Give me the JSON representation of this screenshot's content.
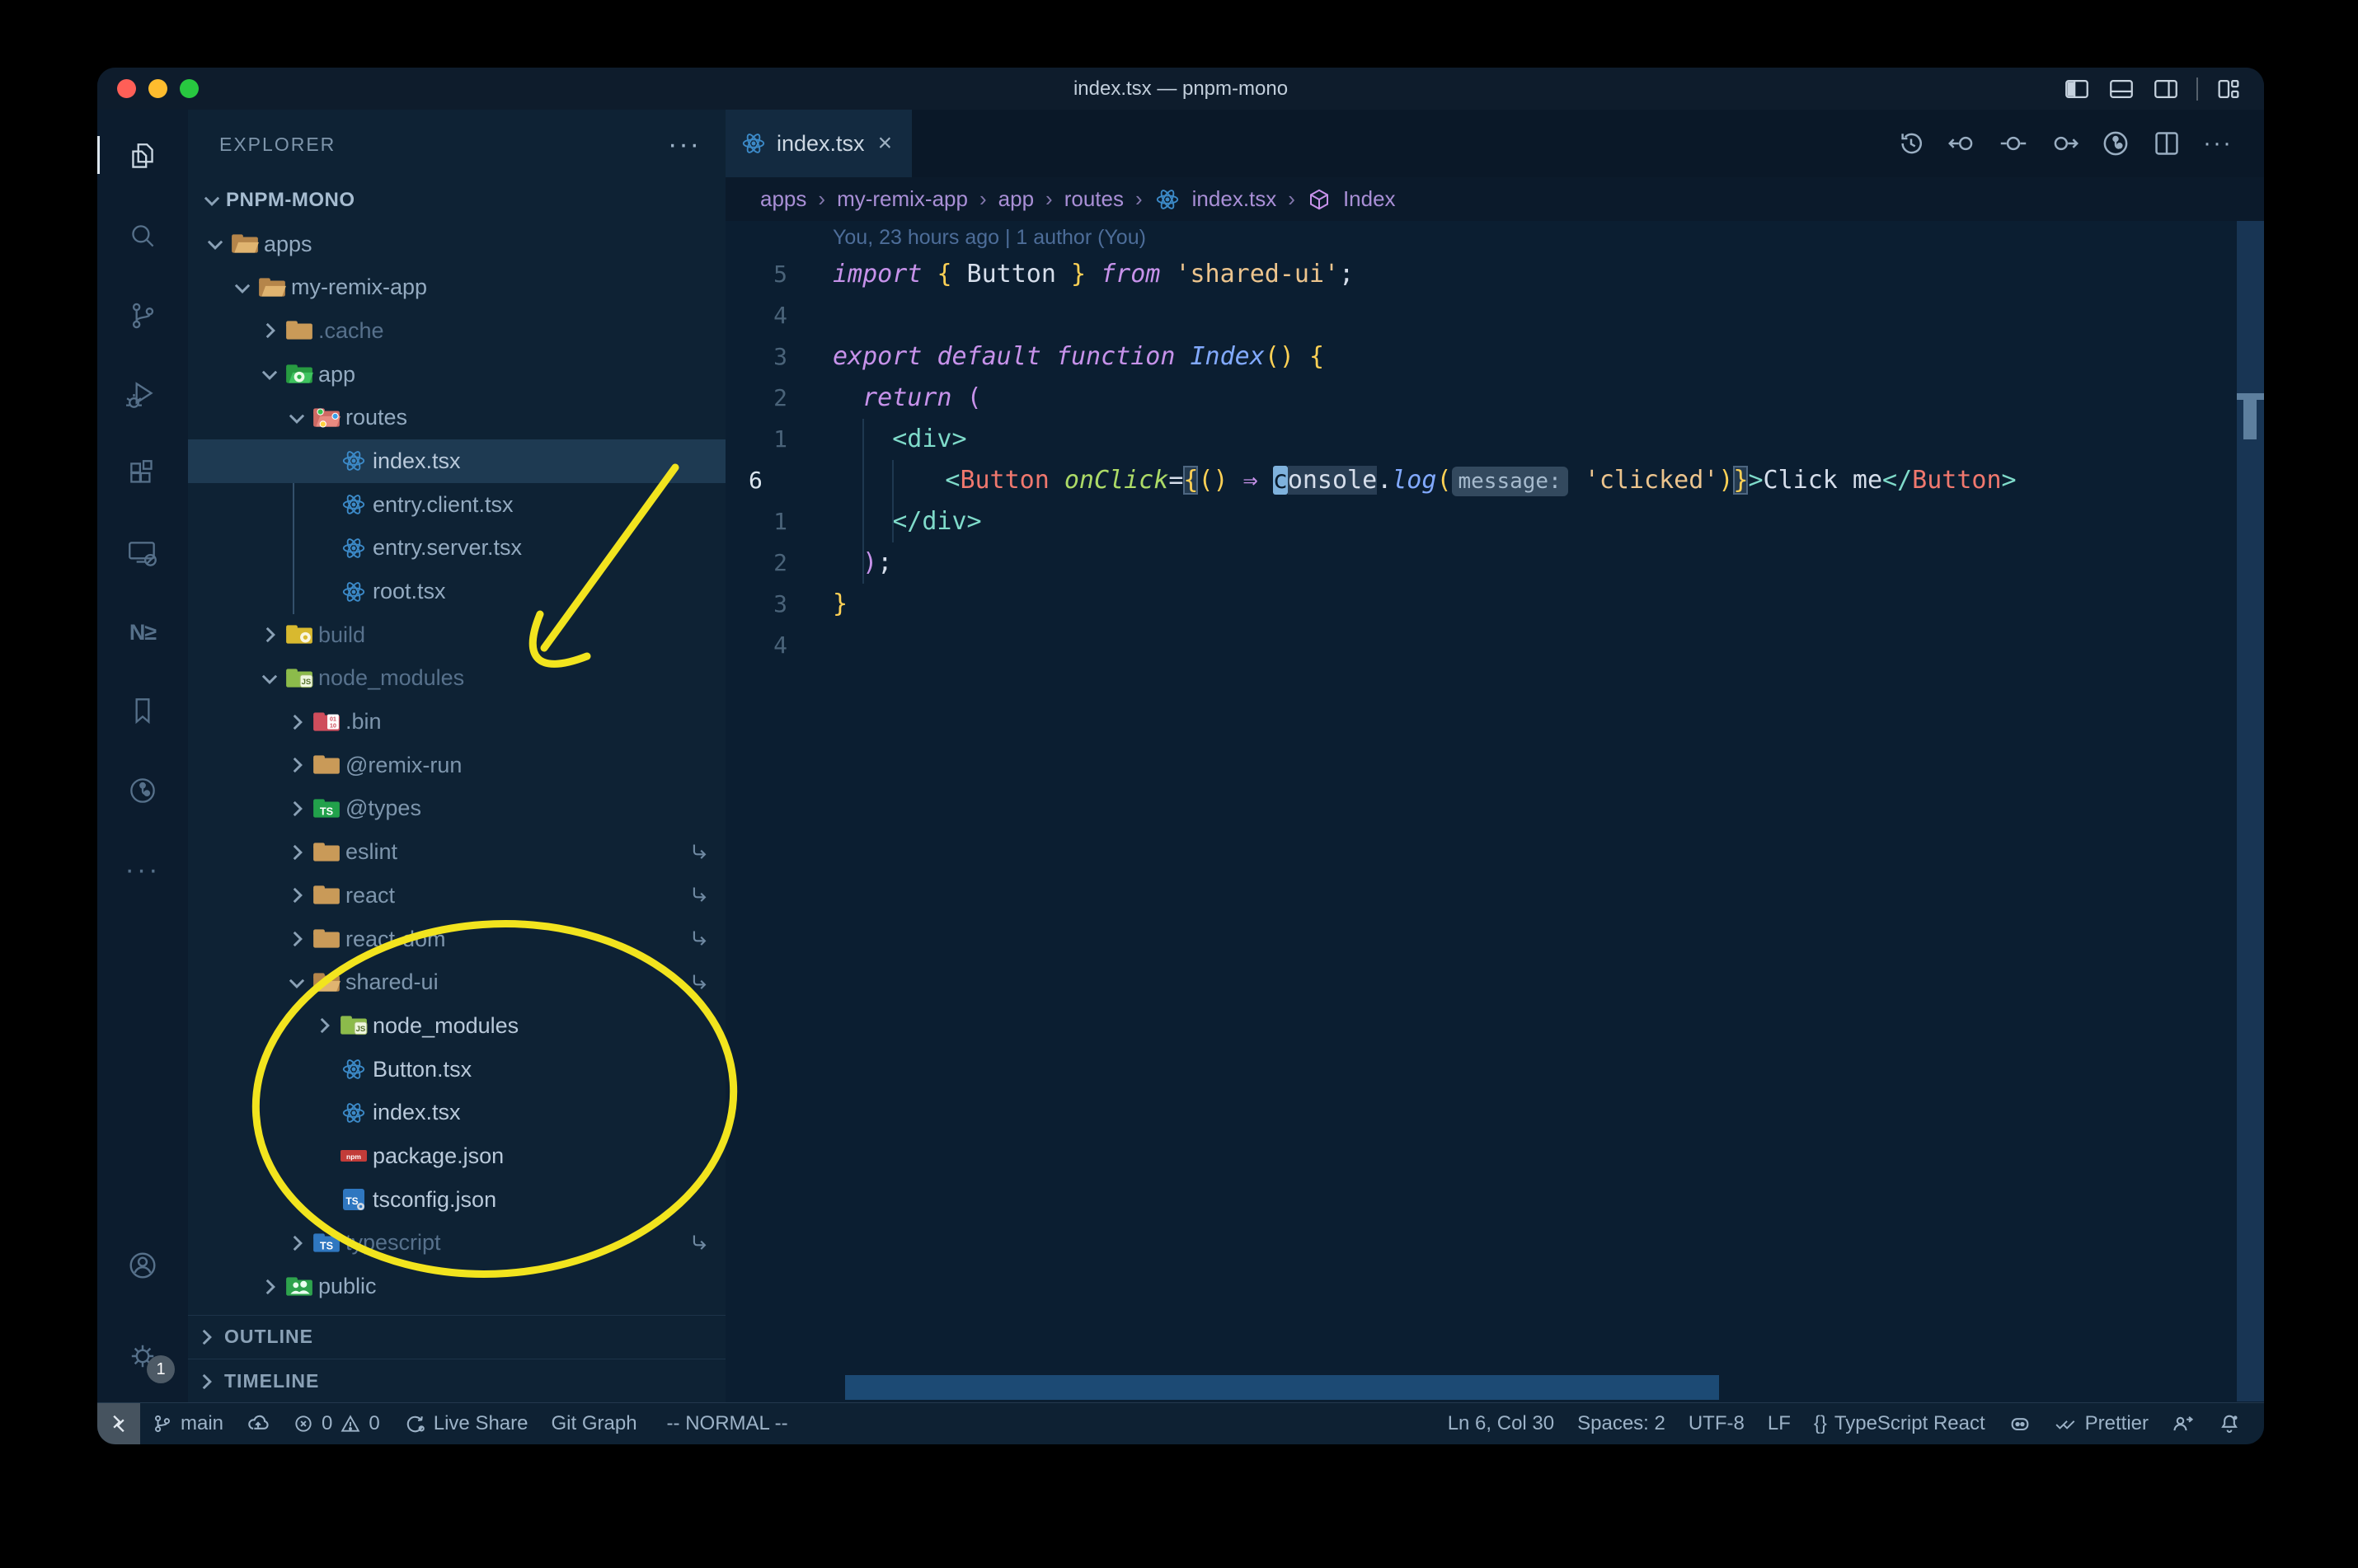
{
  "window": {
    "title": "index.tsx — pnpm-mono"
  },
  "colors": {
    "annotation_yellow": "#f2e41e",
    "editor_bg": "#0b1e31",
    "sidebar_bg": "#0e2234",
    "selection_row": "#1e3a52",
    "keyword_magenta": "#c792ea",
    "function_blue": "#82aaff",
    "string_tan": "#ecc48d",
    "tag_teal": "#7fdbca",
    "component_salmon": "#f0786e",
    "attribute_green": "#addb67",
    "bracket_yellow": "#ffd155",
    "react_blue": "#3c8ac8",
    "traffic_red": "#ff5f57",
    "traffic_yellow": "#febc2e",
    "traffic_green": "#28c840"
  },
  "glyphs": {
    "more_h": "···",
    "tab_close": "×",
    "nx": "N≥",
    "braces": "{}",
    "breadcrumb_sep": "›"
  },
  "activity_bar": {
    "settings_badge": "1"
  },
  "explorer": {
    "header": "EXPLORER",
    "root": "PNPM-MONO",
    "tree": [
      {
        "label": "apps",
        "level": 0,
        "icon": "folder-open",
        "chevron": "down",
        "tone": "normal"
      },
      {
        "label": "my-remix-app",
        "level": 1,
        "icon": "folder-open",
        "chevron": "down",
        "tone": "normal"
      },
      {
        "label": ".cache",
        "level": 2,
        "icon": "folder",
        "chevron": "right",
        "tone": "dim"
      },
      {
        "label": "app",
        "level": 2,
        "icon": "folder-app",
        "chevron": "down",
        "tone": "normal"
      },
      {
        "label": "routes",
        "level": 3,
        "icon": "folder-routes",
        "chevron": "down",
        "tone": "normal"
      },
      {
        "label": "index.tsx",
        "level": 4,
        "icon": "react",
        "chevron": "none",
        "tone": "bright",
        "selected": true
      },
      {
        "label": "entry.client.tsx",
        "level": 4,
        "icon": "react",
        "chevron": "none",
        "tone": "normal"
      },
      {
        "label": "entry.server.tsx",
        "level": 4,
        "icon": "react",
        "chevron": "none",
        "tone": "normal"
      },
      {
        "label": "root.tsx",
        "level": 4,
        "icon": "react",
        "chevron": "none",
        "tone": "normal"
      },
      {
        "label": "build",
        "level": 2,
        "icon": "folder-build",
        "chevron": "right",
        "tone": "dim"
      },
      {
        "label": "node_modules",
        "level": 2,
        "icon": "folder-node",
        "chevron": "down",
        "tone": "dim"
      },
      {
        "label": ".bin",
        "level": 3,
        "icon": "folder-bin",
        "chevron": "right",
        "tone": "mid"
      },
      {
        "label": "@remix-run",
        "level": 3,
        "icon": "folder",
        "chevron": "right",
        "tone": "mid"
      },
      {
        "label": "@types",
        "level": 3,
        "icon": "folder-types",
        "chevron": "right",
        "tone": "mid"
      },
      {
        "label": "eslint",
        "level": 3,
        "icon": "folder",
        "chevron": "right",
        "tone": "mid",
        "symlink": true
      },
      {
        "label": "react",
        "level": 3,
        "icon": "folder",
        "chevron": "right",
        "tone": "mid",
        "symlink": true
      },
      {
        "label": "react-dom",
        "level": 3,
        "icon": "folder",
        "chevron": "right",
        "tone": "mid",
        "symlink": true
      },
      {
        "label": "shared-ui",
        "level": 3,
        "icon": "folder-open",
        "chevron": "down",
        "tone": "mid",
        "symlink": true
      },
      {
        "label": "node_modules",
        "level": 4,
        "icon": "folder-node",
        "chevron": "right",
        "tone": "bright"
      },
      {
        "label": "Button.tsx",
        "level": 4,
        "icon": "react",
        "chevron": "none",
        "tone": "bright"
      },
      {
        "label": "index.tsx",
        "level": 4,
        "icon": "react",
        "chevron": "none",
        "tone": "bright"
      },
      {
        "label": "package.json",
        "level": 4,
        "icon": "npm",
        "chevron": "none",
        "tone": "bright"
      },
      {
        "label": "tsconfig.json",
        "level": 4,
        "icon": "tsconfig",
        "chevron": "none",
        "tone": "bright"
      },
      {
        "label": "typescript",
        "level": 3,
        "icon": "folder-ts",
        "chevron": "right",
        "tone": "dim",
        "symlink": true
      },
      {
        "label": "public",
        "level": 2,
        "icon": "folder-public",
        "chevron": "right",
        "tone": "normal"
      }
    ],
    "sections": [
      {
        "label": "OUTLINE"
      },
      {
        "label": "TIMELINE"
      }
    ]
  },
  "tab": {
    "label": "index.tsx"
  },
  "breadcrumbs": {
    "items": [
      {
        "label": "apps"
      },
      {
        "label": "my-remix-app"
      },
      {
        "label": "app"
      },
      {
        "label": "routes"
      },
      {
        "label": "index.tsx",
        "icon": "react"
      },
      {
        "label": "Index",
        "icon": "symbol-cube"
      }
    ]
  },
  "editor": {
    "annotation": "You, 23 hours ago | 1 author (You)",
    "lines": [
      {
        "gutter": "5",
        "tokens": [
          [
            "kw",
            "import"
          ],
          [
            "wh",
            " "
          ],
          [
            "brY",
            "{"
          ],
          [
            "wh",
            " Button "
          ],
          [
            "brY",
            "}"
          ],
          [
            "wh",
            " "
          ],
          [
            "kw",
            "from"
          ],
          [
            "wh",
            " "
          ],
          [
            "str",
            "'shared-ui'"
          ],
          [
            "wh",
            ";"
          ]
        ]
      },
      {
        "gutter": "4",
        "tokens": []
      },
      {
        "gutter": "3",
        "tokens": [
          [
            "kw",
            "export"
          ],
          [
            "wh",
            " "
          ],
          [
            "kw",
            "default"
          ],
          [
            "wh",
            " "
          ],
          [
            "kw",
            "function"
          ],
          [
            "wh",
            " "
          ],
          [
            "fn",
            "Index"
          ],
          [
            "brY",
            "()"
          ],
          [
            "wh",
            " "
          ],
          [
            "brY",
            "{"
          ]
        ]
      },
      {
        "gutter": "2",
        "tokens": [
          [
            "wh",
            "  "
          ],
          [
            "kw",
            "return"
          ],
          [
            "wh",
            " "
          ],
          [
            "brP",
            "("
          ]
        ]
      },
      {
        "gutter": "1",
        "tokens": [
          [
            "wh",
            "    "
          ],
          [
            "tag",
            "<div>"
          ]
        ]
      },
      {
        "gutter": "6",
        "current": true,
        "tokens": [
          [
            "wh",
            "      "
          ],
          [
            "tag",
            "<"
          ],
          [
            "comp",
            "Button"
          ],
          [
            "wh",
            " "
          ],
          [
            "attr",
            "onClick"
          ],
          [
            "op",
            "="
          ],
          [
            "brYbox",
            "{"
          ],
          [
            "brY",
            "()"
          ],
          [
            "wh",
            " "
          ],
          [
            "arrow",
            "⇒"
          ],
          [
            "wh",
            " "
          ],
          [
            "cursor",
            "c"
          ],
          [
            "word",
            "onsole"
          ],
          [
            "wh",
            "."
          ],
          [
            "fn",
            "log"
          ],
          [
            "brY",
            "("
          ],
          [
            "inlay",
            "message:"
          ],
          [
            "wh",
            " "
          ],
          [
            "str",
            "'clicked'"
          ],
          [
            "brY",
            ")"
          ],
          [
            "brYbox",
            "}"
          ],
          [
            "tag",
            ">"
          ],
          [
            "wh",
            "Click me"
          ],
          [
            "tag",
            "</"
          ],
          [
            "comp",
            "Button"
          ],
          [
            "tag",
            ">"
          ]
        ]
      },
      {
        "gutter": "1",
        "tokens": [
          [
            "wh",
            "    "
          ],
          [
            "tag",
            "</div>"
          ]
        ]
      },
      {
        "gutter": "2",
        "tokens": [
          [
            "wh",
            "  "
          ],
          [
            "brP",
            ")"
          ],
          [
            "wh",
            ";"
          ]
        ]
      },
      {
        "gutter": "3",
        "tokens": [
          [
            "brY",
            "}"
          ]
        ]
      },
      {
        "gutter": "4",
        "tokens": []
      }
    ]
  },
  "status_bar": {
    "branch": "main",
    "errors": "0",
    "warnings": "0",
    "live_share": "Live Share",
    "git_graph": "Git Graph",
    "vim_mode": "-- NORMAL --",
    "cursor_position": "Ln 6, Col 30",
    "indentation": "Spaces: 2",
    "encoding": "UTF-8",
    "eol": "LF",
    "language": "TypeScript React",
    "prettier": "Prettier"
  }
}
